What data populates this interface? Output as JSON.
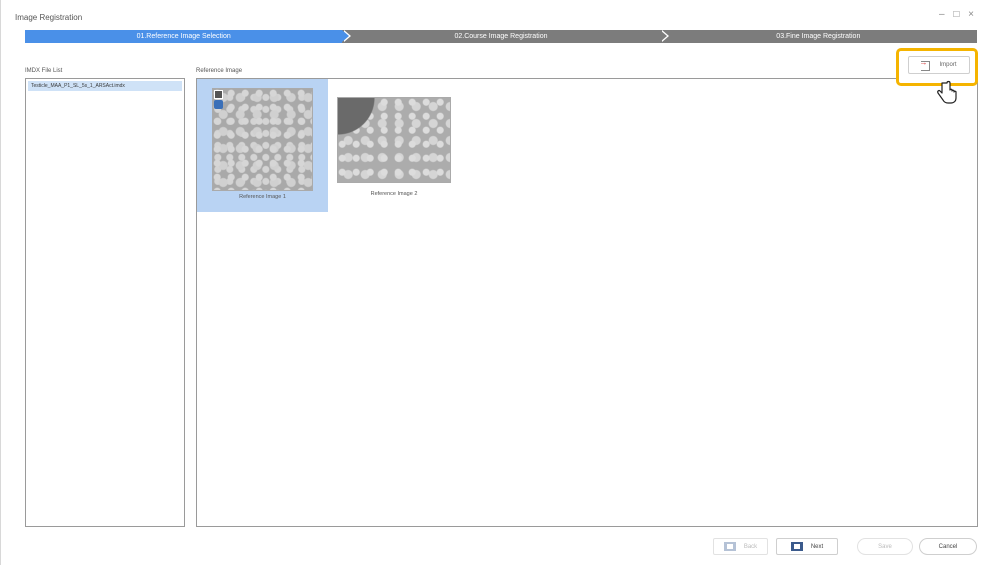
{
  "window": {
    "title": "Image Registration",
    "controls": "– □ ×"
  },
  "stepper": {
    "steps": [
      {
        "label": "01.Reference Image Selection",
        "active": true
      },
      {
        "label": "02.Course Image Registration",
        "active": false
      },
      {
        "label": "03.Fine Image Registration",
        "active": false
      }
    ]
  },
  "file_list": {
    "label": "IMDX File List",
    "items": [
      "Testicle_MAA_P1_SL_5s_1_ARSAct.imdx"
    ]
  },
  "reference": {
    "label": "Reference Image",
    "images": [
      {
        "caption": "Reference Image 1",
        "selected": true
      },
      {
        "caption": "Reference Image 2",
        "selected": false
      }
    ]
  },
  "toolbar": {
    "import_label": "Import"
  },
  "footer": {
    "back_label": "Back",
    "next_label": "Next",
    "save_label": "Save",
    "cancel_label": "Cancel"
  },
  "colors": {
    "step_active": "#4a90e8",
    "step_inactive": "#7c7c7c",
    "selection": "#b9d3f3",
    "highlight": "#f5b400"
  }
}
